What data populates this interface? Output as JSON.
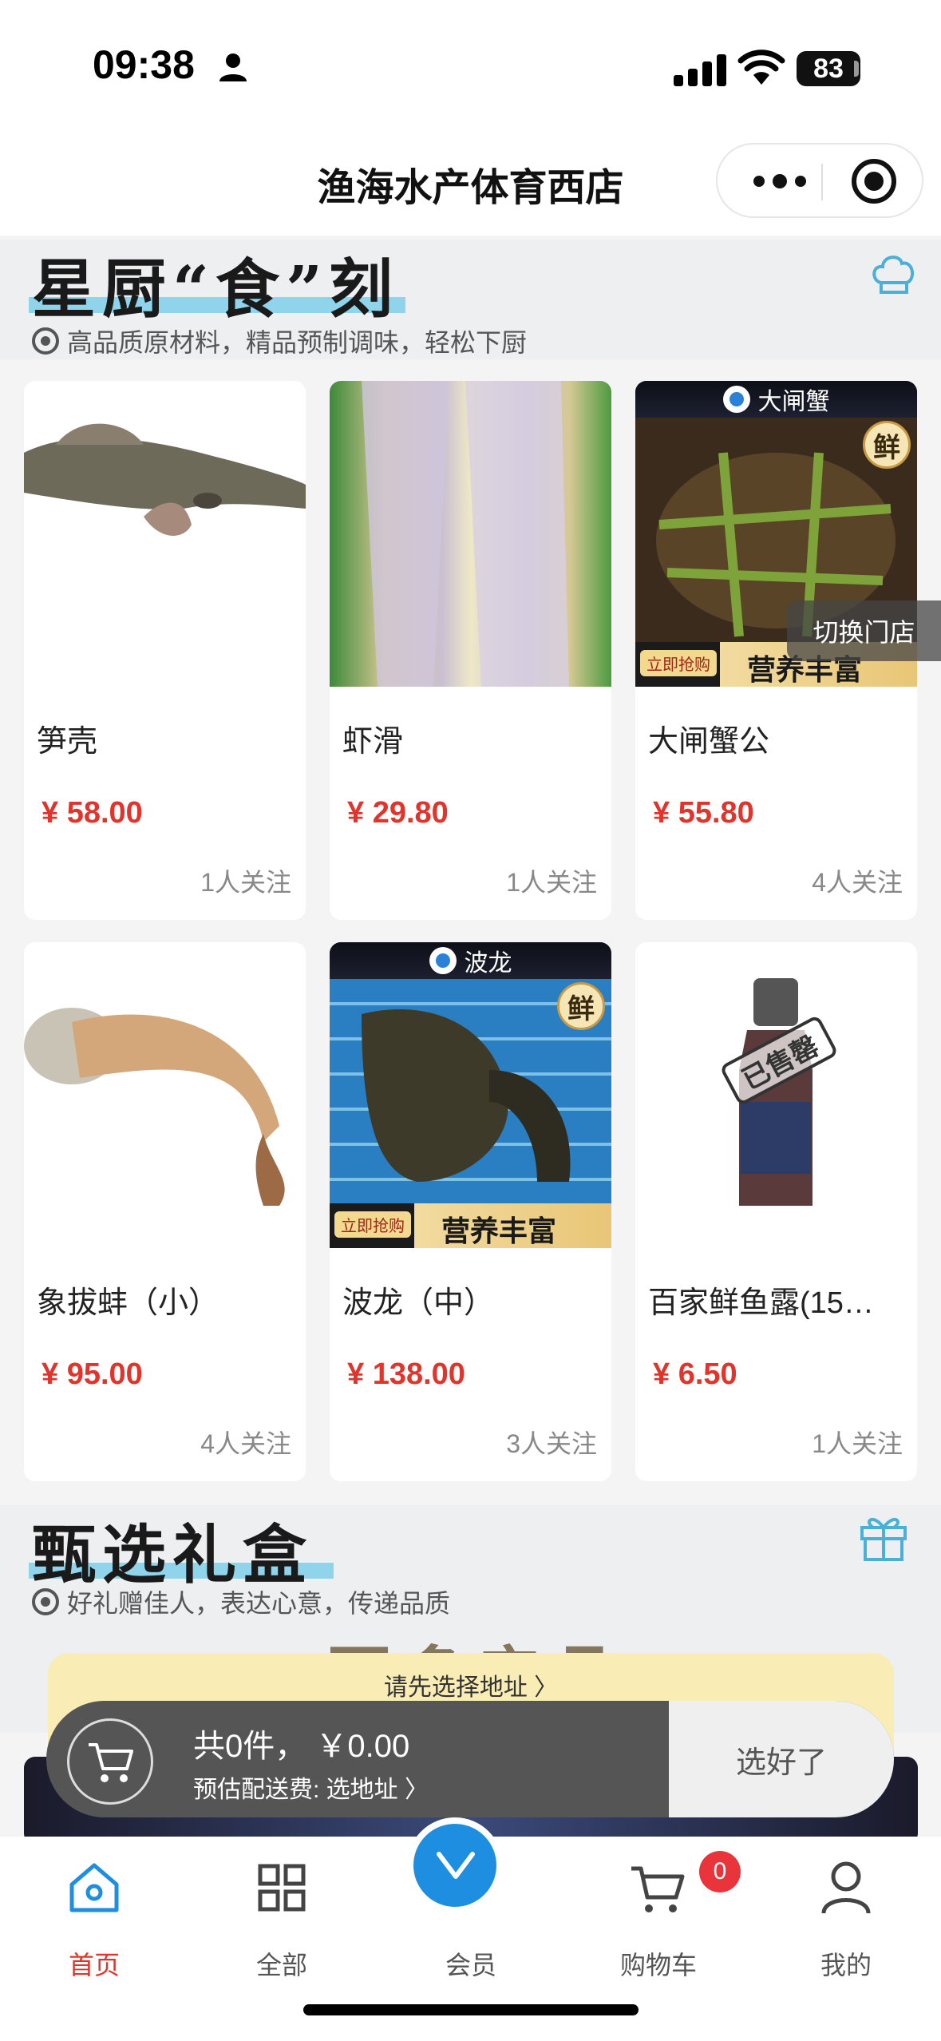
{
  "status_bar": {
    "time": "09:38",
    "battery": "83"
  },
  "nav": {
    "title": "渔海水产体育西店"
  },
  "section1": {
    "title": "星厨“食”刻",
    "subtitle": "高品质原材料，精品预制调味，轻松下厨"
  },
  "switch_store_label": "切换门店",
  "products": [
    {
      "name": "笋壳",
      "price": "¥ 58.00",
      "follow": "1人关注"
    },
    {
      "name": "虾滑",
      "price": "¥ 29.80",
      "follow": "1人关注"
    },
    {
      "name": "大闸蟹公",
      "price": "¥ 55.80",
      "follow": "4人关注",
      "banner_top": "大闸蟹",
      "badge": "鲜",
      "banner_left": "立即抢购",
      "banner_right": "营养丰富"
    },
    {
      "name": "象拔蚌（小）",
      "price": "¥ 95.00",
      "follow": "4人关注"
    },
    {
      "name": "波龙（中）",
      "price": "¥ 138.00",
      "follow": "3人关注",
      "banner_top": "波龙",
      "badge": "鲜",
      "banner_left": "立即抢购",
      "banner_right": "营养丰富"
    },
    {
      "name": "百家鲜鱼露(15…",
      "price": "¥ 6.50",
      "follow": "1人关注",
      "stamp": "已售罄"
    }
  ],
  "section2": {
    "title": "甄选礼盒",
    "subtitle": "好礼赠佳人，表达心意，传递品质",
    "more": "更多产品"
  },
  "address_prompt": "请先选择地址 〉",
  "cart": {
    "total": "共0件， ￥0.00",
    "delivery": "预估配送费: 选地址 〉",
    "done": "选好了",
    "badge": "0"
  },
  "tabs": [
    {
      "label": "首页",
      "active": true
    },
    {
      "label": "全部"
    },
    {
      "label": "会员"
    },
    {
      "label": "购物车"
    },
    {
      "label": "我的"
    }
  ],
  "colors": {
    "accent": "#e0342c",
    "member": "#1e8ee0",
    "highlight": "#8fd4ea"
  }
}
